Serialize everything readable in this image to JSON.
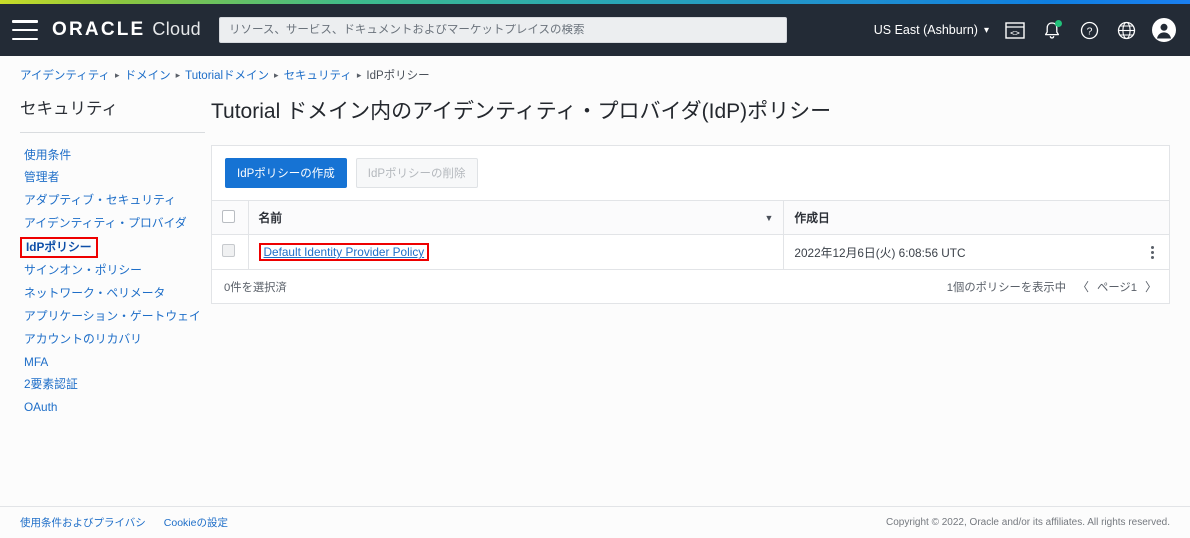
{
  "header": {
    "menu_icon": "hamburger-icon",
    "brand_oracle": "ORACLE",
    "brand_cloud": "Cloud",
    "search_placeholder": "リソース、サービス、ドキュメントおよびマーケットプレイスの検索",
    "search_value": "",
    "region": "US East (Ashburn)",
    "region_chevron": "⌄",
    "icons": [
      {
        "name": "cloud-shell-icon",
        "label": "Cloud Shell"
      },
      {
        "name": "notifications-bell-icon",
        "label": "通知"
      },
      {
        "name": "help-icon",
        "label": "ヘルプ"
      },
      {
        "name": "language-globe-icon",
        "label": "言語"
      },
      {
        "name": "user-avatar-icon",
        "label": "プロファイル"
      }
    ],
    "accent_gradient_start": "#c8dc28",
    "accent_gradient_end": "#1a7ff0",
    "background": "#232b36"
  },
  "breadcrumb": {
    "separator": "▸",
    "items": [
      {
        "label": "アイデンティティ",
        "current": false
      },
      {
        "label": "ドメイン",
        "current": false
      },
      {
        "label": "Tutorialドメイン",
        "current": false
      },
      {
        "label": "セキュリティ",
        "current": false
      },
      {
        "label": "IdPポリシー",
        "current": true
      }
    ]
  },
  "sidebar": {
    "title": "セキュリティ",
    "items": [
      {
        "label": "使用条件",
        "active": false
      },
      {
        "label": "管理者",
        "active": false
      },
      {
        "label": "アダプティブ・セキュリティ",
        "active": false
      },
      {
        "label": "アイデンティティ・プロバイダ",
        "active": false
      },
      {
        "label": "IdPポリシー",
        "active": true
      },
      {
        "label": "サインオン・ポリシー",
        "active": false
      },
      {
        "label": "ネットワーク・ペリメータ",
        "active": false
      },
      {
        "label": "アプリケーション・ゲートウェイ",
        "active": false
      },
      {
        "label": "アカウントのリカバリ",
        "active": false
      },
      {
        "label": "MFA",
        "active": false
      },
      {
        "label": "2要素認証",
        "active": false
      },
      {
        "label": "OAuth",
        "active": false
      }
    ],
    "highlight_color": "#ee0000"
  },
  "main": {
    "page_title": "Tutorial ドメイン内のアイデンティティ・プロバイダ(IdP)ポリシー",
    "toolbar": {
      "create_label": "IdPポリシーの作成",
      "delete_label": "IdPポリシーの削除",
      "primary_color": "#1673d4"
    },
    "table": {
      "columns": [
        {
          "key": "select",
          "label": ""
        },
        {
          "key": "name",
          "label": "名前",
          "sortable": true
        },
        {
          "key": "created",
          "label": "作成日",
          "sortable": false
        }
      ],
      "sort_caret": "▼",
      "rows": [
        {
          "name": "Default Identity Provider Policy",
          "created": "2022年12月6日(火) 6:08:56 UTC",
          "selected": false,
          "highlighted": true
        }
      ],
      "footer": {
        "selected_count_label": "0件を選択済",
        "showing_label": "1個のポリシーを表示中",
        "prev_arrow": "〈",
        "page_label": "ページ1",
        "next_arrow": "〉"
      }
    }
  },
  "footer": {
    "links": [
      {
        "label": "使用条件およびプライバシ"
      },
      {
        "label": "Cookieの設定"
      }
    ],
    "copyright": "Copyright © 2022, Oracle and/or its affiliates. All rights reserved."
  }
}
